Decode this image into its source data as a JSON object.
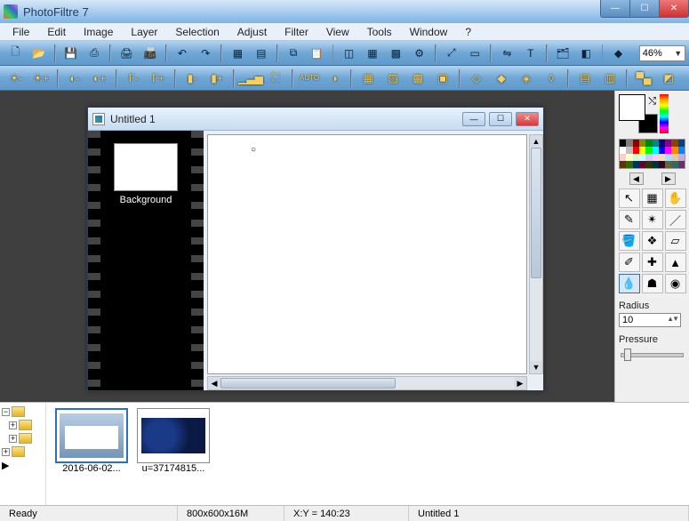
{
  "app": {
    "title": "PhotoFiltre 7"
  },
  "menus": [
    "File",
    "Edit",
    "Image",
    "Layer",
    "Selection",
    "Adjust",
    "Filter",
    "View",
    "Tools",
    "Window",
    "?"
  ],
  "zoom": "46%",
  "doc": {
    "title": "Untitled 1",
    "layer_label": "Background"
  },
  "right": {
    "radius_label": "Radius",
    "radius_value": "10",
    "pressure_label": "Pressure"
  },
  "thumbs": [
    {
      "label": "2016-06-02..."
    },
    {
      "label": "u=37174815..."
    }
  ],
  "status": {
    "ready": "Ready",
    "dims": "800x600x16M",
    "xy": "X:Y = 140:23",
    "docname": "Untitled 1"
  },
  "swatches": [
    "#000000",
    "#7f7f7f",
    "#880000",
    "#888800",
    "#008800",
    "#008888",
    "#000088",
    "#880088",
    "#884400",
    "#004488",
    "#ffffff",
    "#c0c0c0",
    "#ff0000",
    "#ffff00",
    "#00ff00",
    "#00ffff",
    "#0000ff",
    "#ff00ff",
    "#ff8800",
    "#0088ff",
    "#ffcccc",
    "#ffffcc",
    "#ccffcc",
    "#ccffff",
    "#ccccff",
    "#ffccff",
    "#ffddaa",
    "#aaddff",
    "#ddccaa",
    "#ccaadd",
    "#663300",
    "#336600",
    "#003366",
    "#660033",
    "#333300",
    "#003333",
    "#330033",
    "#666633",
    "#336666",
    "#663366"
  ]
}
